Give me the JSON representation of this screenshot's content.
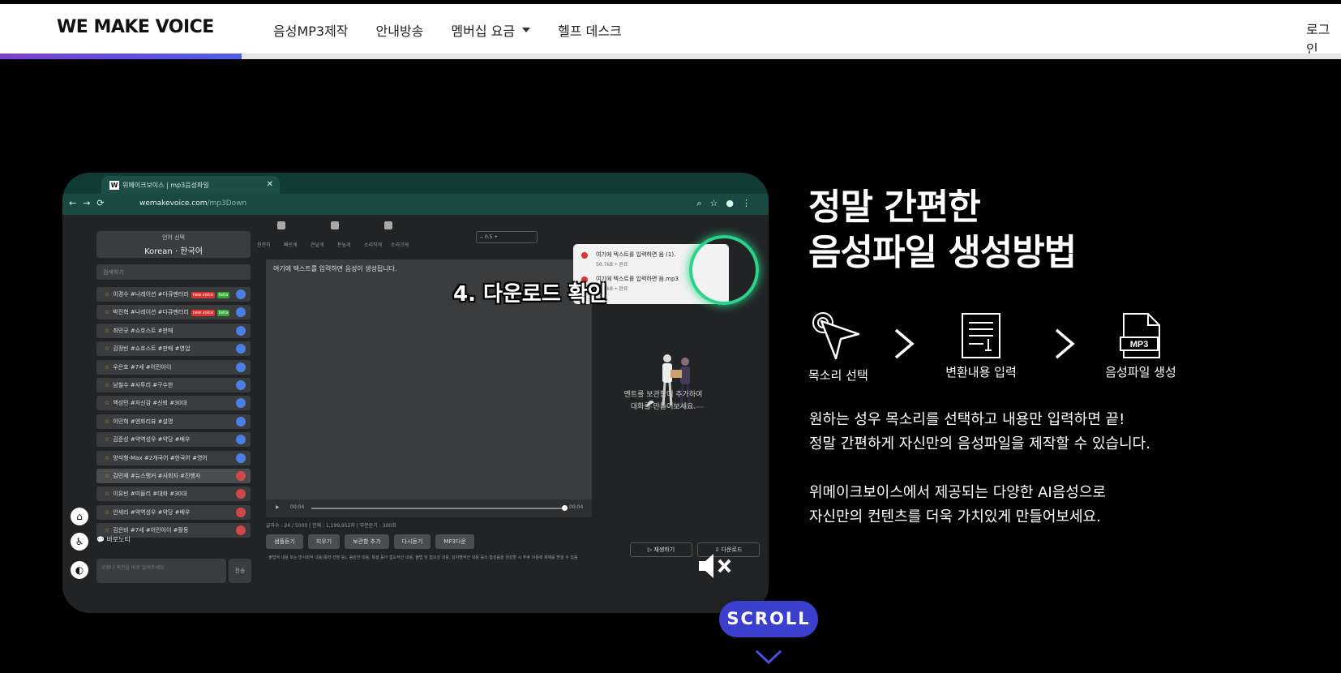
{
  "nav": {
    "logo": "WE MAKE VOICE",
    "menu": [
      {
        "label": "음성MP3제작"
      },
      {
        "label": "안내방송"
      },
      {
        "label": "멤버십 요금"
      },
      {
        "label": "헬프 데스크"
      }
    ],
    "login": "로그인",
    "page_progress": 0.18
  },
  "video": {
    "tab_title": "위메이크보이스 | mp3음성파일",
    "url_host": "wemakevoice.com",
    "url_path": "/mp3Down",
    "lang_label": "언어 선택",
    "lang_value": "Korean · 한국어",
    "search_placeholder": "검색하기",
    "voices": [
      {
        "label": "이경수 #나레이션 #다큐멘터리",
        "new": "new voice",
        "beta": "beta"
      },
      {
        "label": "박진혁 #나레이션 #다큐멘터리",
        "new": "new voice",
        "beta": "beta"
      },
      {
        "label": "최민규 #쇼호스트 #판매"
      },
      {
        "label": "김정빈 #쇼호스트 #판매 #영업"
      },
      {
        "label": "우은호 #7세 #어린아이"
      },
      {
        "label": "남철수 #사투리 #구수한"
      },
      {
        "label": "백성민 #자신감 #신뢰 #30대"
      },
      {
        "label": "이민혁 #엔화리뷰 #설명"
      },
      {
        "label": "김준성 #약역성우 #약당 #배우"
      },
      {
        "label": "양석형-Max #2개국어 #한국어 #영어"
      },
      {
        "label": "김민재 #뉴스앵커 #사회자 #진행자"
      },
      {
        "label": "이유빈 #미들리 #대화 #30대"
      },
      {
        "label": "안세리 #약역성우 #약당 #배우"
      },
      {
        "label": "김은비 #7세 #어린아이 #활동"
      }
    ],
    "sliders": [
      "친전히",
      "빠르게",
      "큰날게",
      "돈높게",
      "소리작게",
      "소리크게"
    ],
    "speed": "0.5",
    "editor_text": "여기에 텍스트를 입력하면 음성이 생성됩니다.",
    "caption": "4. 다운로드 확인",
    "time_start": "00:04",
    "time_end": "00:04",
    "char_count": "글자수 : 24 / 5000 | 전체 : 1,199,952자 | 부분듣기 : 300회",
    "buttons": [
      "샘플듣기",
      "지우기",
      "보관함 추가",
      "다시듣기",
      "MP3다운"
    ],
    "footnote": "· 불법적 내용 또는 반사회적 내용(폭력·선정 등), 음란한 내용, 욕설 등의 혐오적인 내용, 불법 및 혐오성 내용, 성차별적인 내용 등의 합성음을 생성할 시 추후 이용에 제재를 받을 수 있음",
    "empty_text": [
      "멘트를 보관함에 추가하여",
      "대화를 만들어보세요."
    ],
    "right_buttons": [
      "재생하기",
      "다운로드"
    ],
    "chat_title": "바로노티",
    "chat_placeholder": "오류나 의견을 바로 알려주세요",
    "send": "전송",
    "downloads": [
      {
        "name": "여기에 텍스트를 입력하면 음 (1).",
        "size": "50.7kB • 완료"
      },
      {
        "name": "여기에 텍스트를 입력하면 음.mp3",
        "size": "50.7kB • 완료"
      }
    ]
  },
  "scroll_label": "SCROLL",
  "right": {
    "heading_line1": "정말 간편한",
    "heading_line2": "음성파일 생성방법",
    "steps": [
      "목소리 선택",
      "변환내용 입력",
      "음성파일 생성"
    ],
    "mp3_label": "MP3",
    "desc1": [
      "원하는 성우 목소리를 선택하고 내용만 입력하면 끝!",
      "정말 간편하게 자신만의 음성파일을 제작할 수 있습니다."
    ],
    "desc2": [
      "위메이크보이스에서 제공되는 다양한 AI음성으로",
      "자신만의 컨텐츠를 더욱 가치있게 만들어보세요."
    ]
  }
}
